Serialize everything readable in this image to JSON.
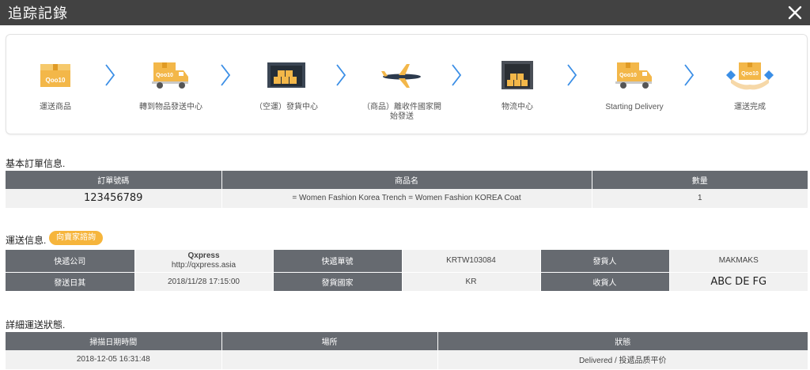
{
  "window": {
    "title": "追踪記錄",
    "close_icon": "close-icon"
  },
  "steps": [
    {
      "label": "運送商品",
      "icon": "qoo10-box-icon"
    },
    {
      "label": "轉到物品發送中心",
      "icon": "delivery-truck-icon"
    },
    {
      "label": "（空運）發貨中心",
      "icon": "warehouse-icon"
    },
    {
      "label": "（商品）離收件國家開始發送",
      "icon": "airplane-icon"
    },
    {
      "label": "物流中心",
      "icon": "logistics-center-icon"
    },
    {
      "label": "Starting Delivery",
      "icon": "delivery-truck-icon"
    },
    {
      "label": "運送完成",
      "icon": "delivered-hands-icon"
    }
  ],
  "order_info": {
    "title": "基本訂單信息.",
    "headers": [
      "訂單號碼",
      "商品名",
      "數量"
    ],
    "row": {
      "order_no": "123456789",
      "product": "= Women Fashion Korea Trench = Women Fashion KOREA Coat",
      "qty": "1"
    }
  },
  "shipping_info": {
    "title": "運送信息.",
    "badge": "向賣家諮詢",
    "courier_label": "快遞公司",
    "courier_name": "Qxpress",
    "courier_url": "http://qxpress.asia",
    "tracking_label": "快遞單號",
    "tracking_no": "KRTW103084",
    "sender_label": "發貨人",
    "sender": "MAKMAKS",
    "ship_date_label": "發送日其",
    "ship_date": "2018/11/28 17:15:00",
    "origin_label": "發貨國家",
    "origin": "KR",
    "receiver_label": "收貨人",
    "receiver": "ABC DE FG"
  },
  "detail_status": {
    "title": "詳細運送狀態.",
    "headers": [
      "掃描日期時間",
      "場所",
      "狀態"
    ],
    "rows": [
      {
        "datetime": "2018-12-05 16:31:48",
        "place": "",
        "status": "Delivered / 投遞品质平价"
      }
    ]
  },
  "colors": {
    "titlebar": "#424242",
    "table_header": "#666a70",
    "accent": "#f6b53c",
    "chevron": "#3a8ee6"
  }
}
